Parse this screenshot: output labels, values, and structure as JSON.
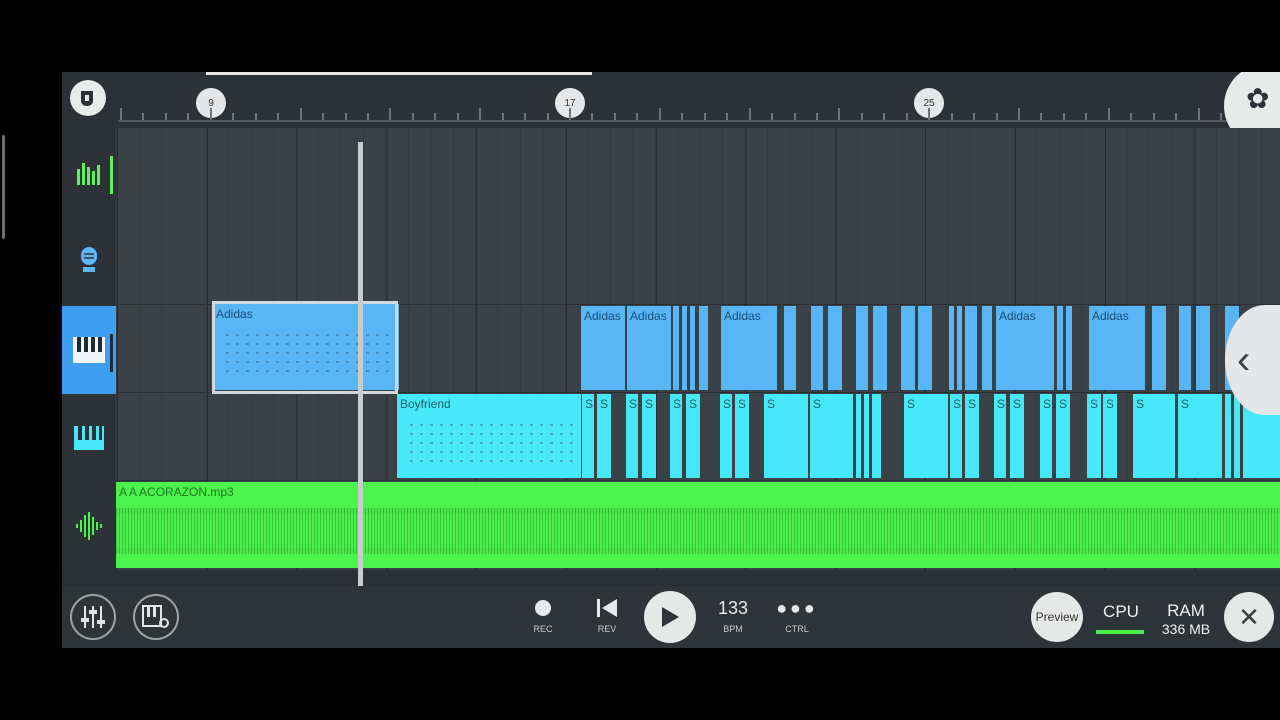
{
  "ruler": {
    "markers": [
      "9",
      "17",
      "25"
    ]
  },
  "clips": {
    "adidas_main": "Adidas",
    "adidas_1": "Adidas",
    "adidas_2": "Adidas",
    "adidas_3": "Adidas",
    "adidas_4": "Adidas",
    "adidas_5": "Adidas",
    "boyfriend": "Boyfriend",
    "s_short": "S",
    "audio": "A A ACORAZON.mp3"
  },
  "transport": {
    "rec_label": "REC",
    "rev_label": "REV",
    "bpm_value": "133",
    "bpm_label": "BPM",
    "ctrl_label": "CTRL"
  },
  "status": {
    "preview_label": "Preview",
    "cpu_label": "CPU",
    "ram_label": "RAM",
    "ram_value": "336 MB"
  },
  "colors": {
    "pattern": "#58b6f6",
    "pattern2": "#47e8f8",
    "audio": "#4cf34c",
    "selected_track": "#3f9ef0"
  }
}
